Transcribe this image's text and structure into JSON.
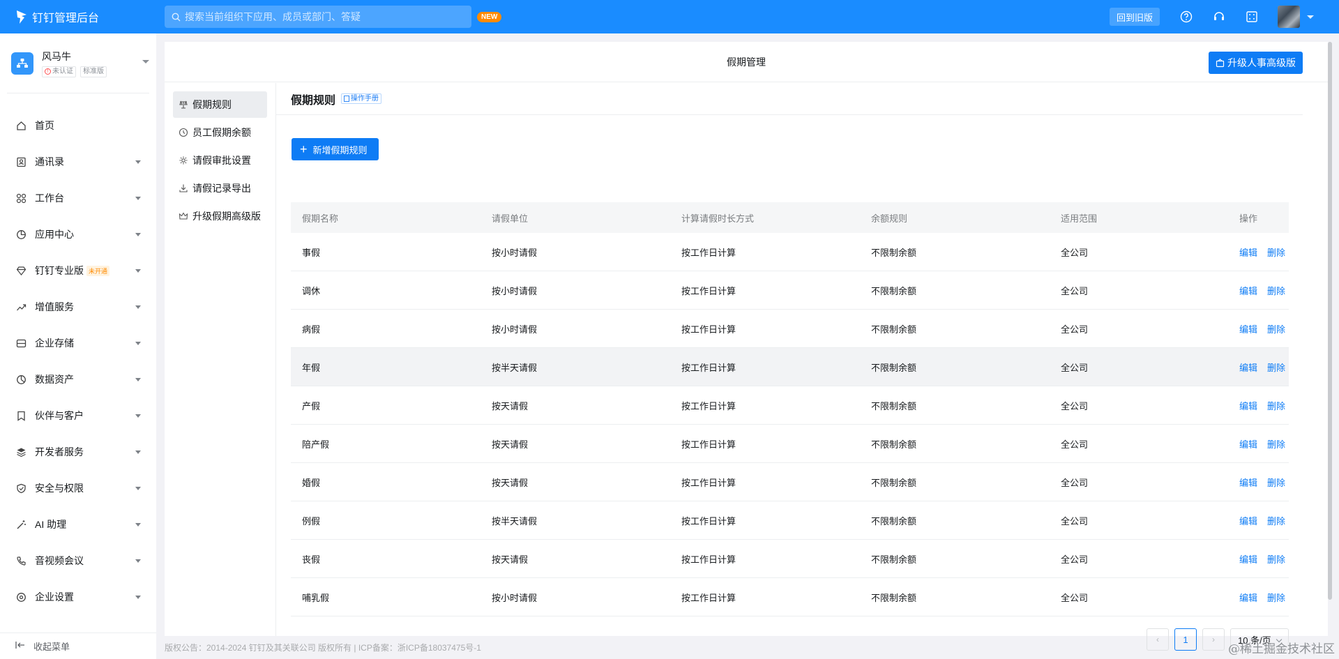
{
  "app": {
    "title": "钉钉管理后台",
    "search_placeholder": "搜索当前组织下应用、成员或部门、答疑",
    "new_badge": "NEW",
    "old_version_label": "回到旧版",
    "accent_color": "#1a8cff"
  },
  "org": {
    "name": "风马牛",
    "tag_unverified": "未认证",
    "tag_edition": "标准版"
  },
  "sidebar": {
    "items": [
      {
        "label": "首页",
        "icon": "home-icon"
      },
      {
        "label": "通讯录",
        "icon": "contacts-icon"
      },
      {
        "label": "工作台",
        "icon": "grid-icon"
      },
      {
        "label": "应用中心",
        "icon": "apps-icon"
      },
      {
        "label": "钉钉专业版",
        "icon": "diamond-icon",
        "badge": "未开通"
      },
      {
        "label": "增值服务",
        "icon": "trend-icon"
      },
      {
        "label": "企业存储",
        "icon": "storage-icon"
      },
      {
        "label": "数据资产",
        "icon": "pie-icon"
      },
      {
        "label": "伙伴与客户",
        "icon": "bookmark-icon"
      },
      {
        "label": "开发者服务",
        "icon": "layers-icon"
      },
      {
        "label": "安全与权限",
        "icon": "shield-icon"
      },
      {
        "label": "AI 助理",
        "icon": "wand-icon"
      },
      {
        "label": "音视频会议",
        "icon": "phone-icon"
      },
      {
        "label": "企业设置",
        "icon": "settings-icon"
      }
    ],
    "collapse_label": "收起菜单"
  },
  "page": {
    "header_title": "假期管理",
    "upgrade_button": "升级人事高级版"
  },
  "subnav": {
    "items": [
      {
        "label": "假期规则",
        "icon": "rule-icon"
      },
      {
        "label": "员工假期余额",
        "icon": "clock-icon"
      },
      {
        "label": "请假审批设置",
        "icon": "gear-icon"
      },
      {
        "label": "请假记录导出",
        "icon": "download-icon"
      },
      {
        "label": "升级假期高级版",
        "icon": "crown-icon"
      }
    ]
  },
  "content": {
    "title": "假期规则",
    "manual_label": "操作手册",
    "add_button": "新增假期规则"
  },
  "table": {
    "headers": [
      "假期名称",
      "请假单位",
      "计算请假时长方式",
      "余额规则",
      "适用范围",
      "操作"
    ],
    "rows": [
      [
        "事假",
        "按小时请假",
        "按工作日计算",
        "不限制余额",
        "全公司"
      ],
      [
        "调休",
        "按小时请假",
        "按工作日计算",
        "不限制余额",
        "全公司"
      ],
      [
        "病假",
        "按小时请假",
        "按工作日计算",
        "不限制余额",
        "全公司"
      ],
      [
        "年假",
        "按半天请假",
        "按工作日计算",
        "不限制余额",
        "全公司"
      ],
      [
        "产假",
        "按天请假",
        "按工作日计算",
        "不限制余额",
        "全公司"
      ],
      [
        "陪产假",
        "按天请假",
        "按工作日计算",
        "不限制余额",
        "全公司"
      ],
      [
        "婚假",
        "按天请假",
        "按工作日计算",
        "不限制余额",
        "全公司"
      ],
      [
        "例假",
        "按半天请假",
        "按工作日计算",
        "不限制余额",
        "全公司"
      ],
      [
        "丧假",
        "按天请假",
        "按工作日计算",
        "不限制余额",
        "全公司"
      ],
      [
        "哺乳假",
        "按小时请假",
        "按工作日计算",
        "不限制余额",
        "全公司"
      ]
    ],
    "edit_label": "编辑",
    "delete_label": "删除"
  },
  "pager": {
    "current_page": "1",
    "page_size": "10 条/页"
  },
  "footer": "版权公告：2014-2024 钉钉及其关联公司 版权所有 | ICP备案：浙ICP备18037475号-1",
  "watermark": "@稀土掘金技术社区"
}
